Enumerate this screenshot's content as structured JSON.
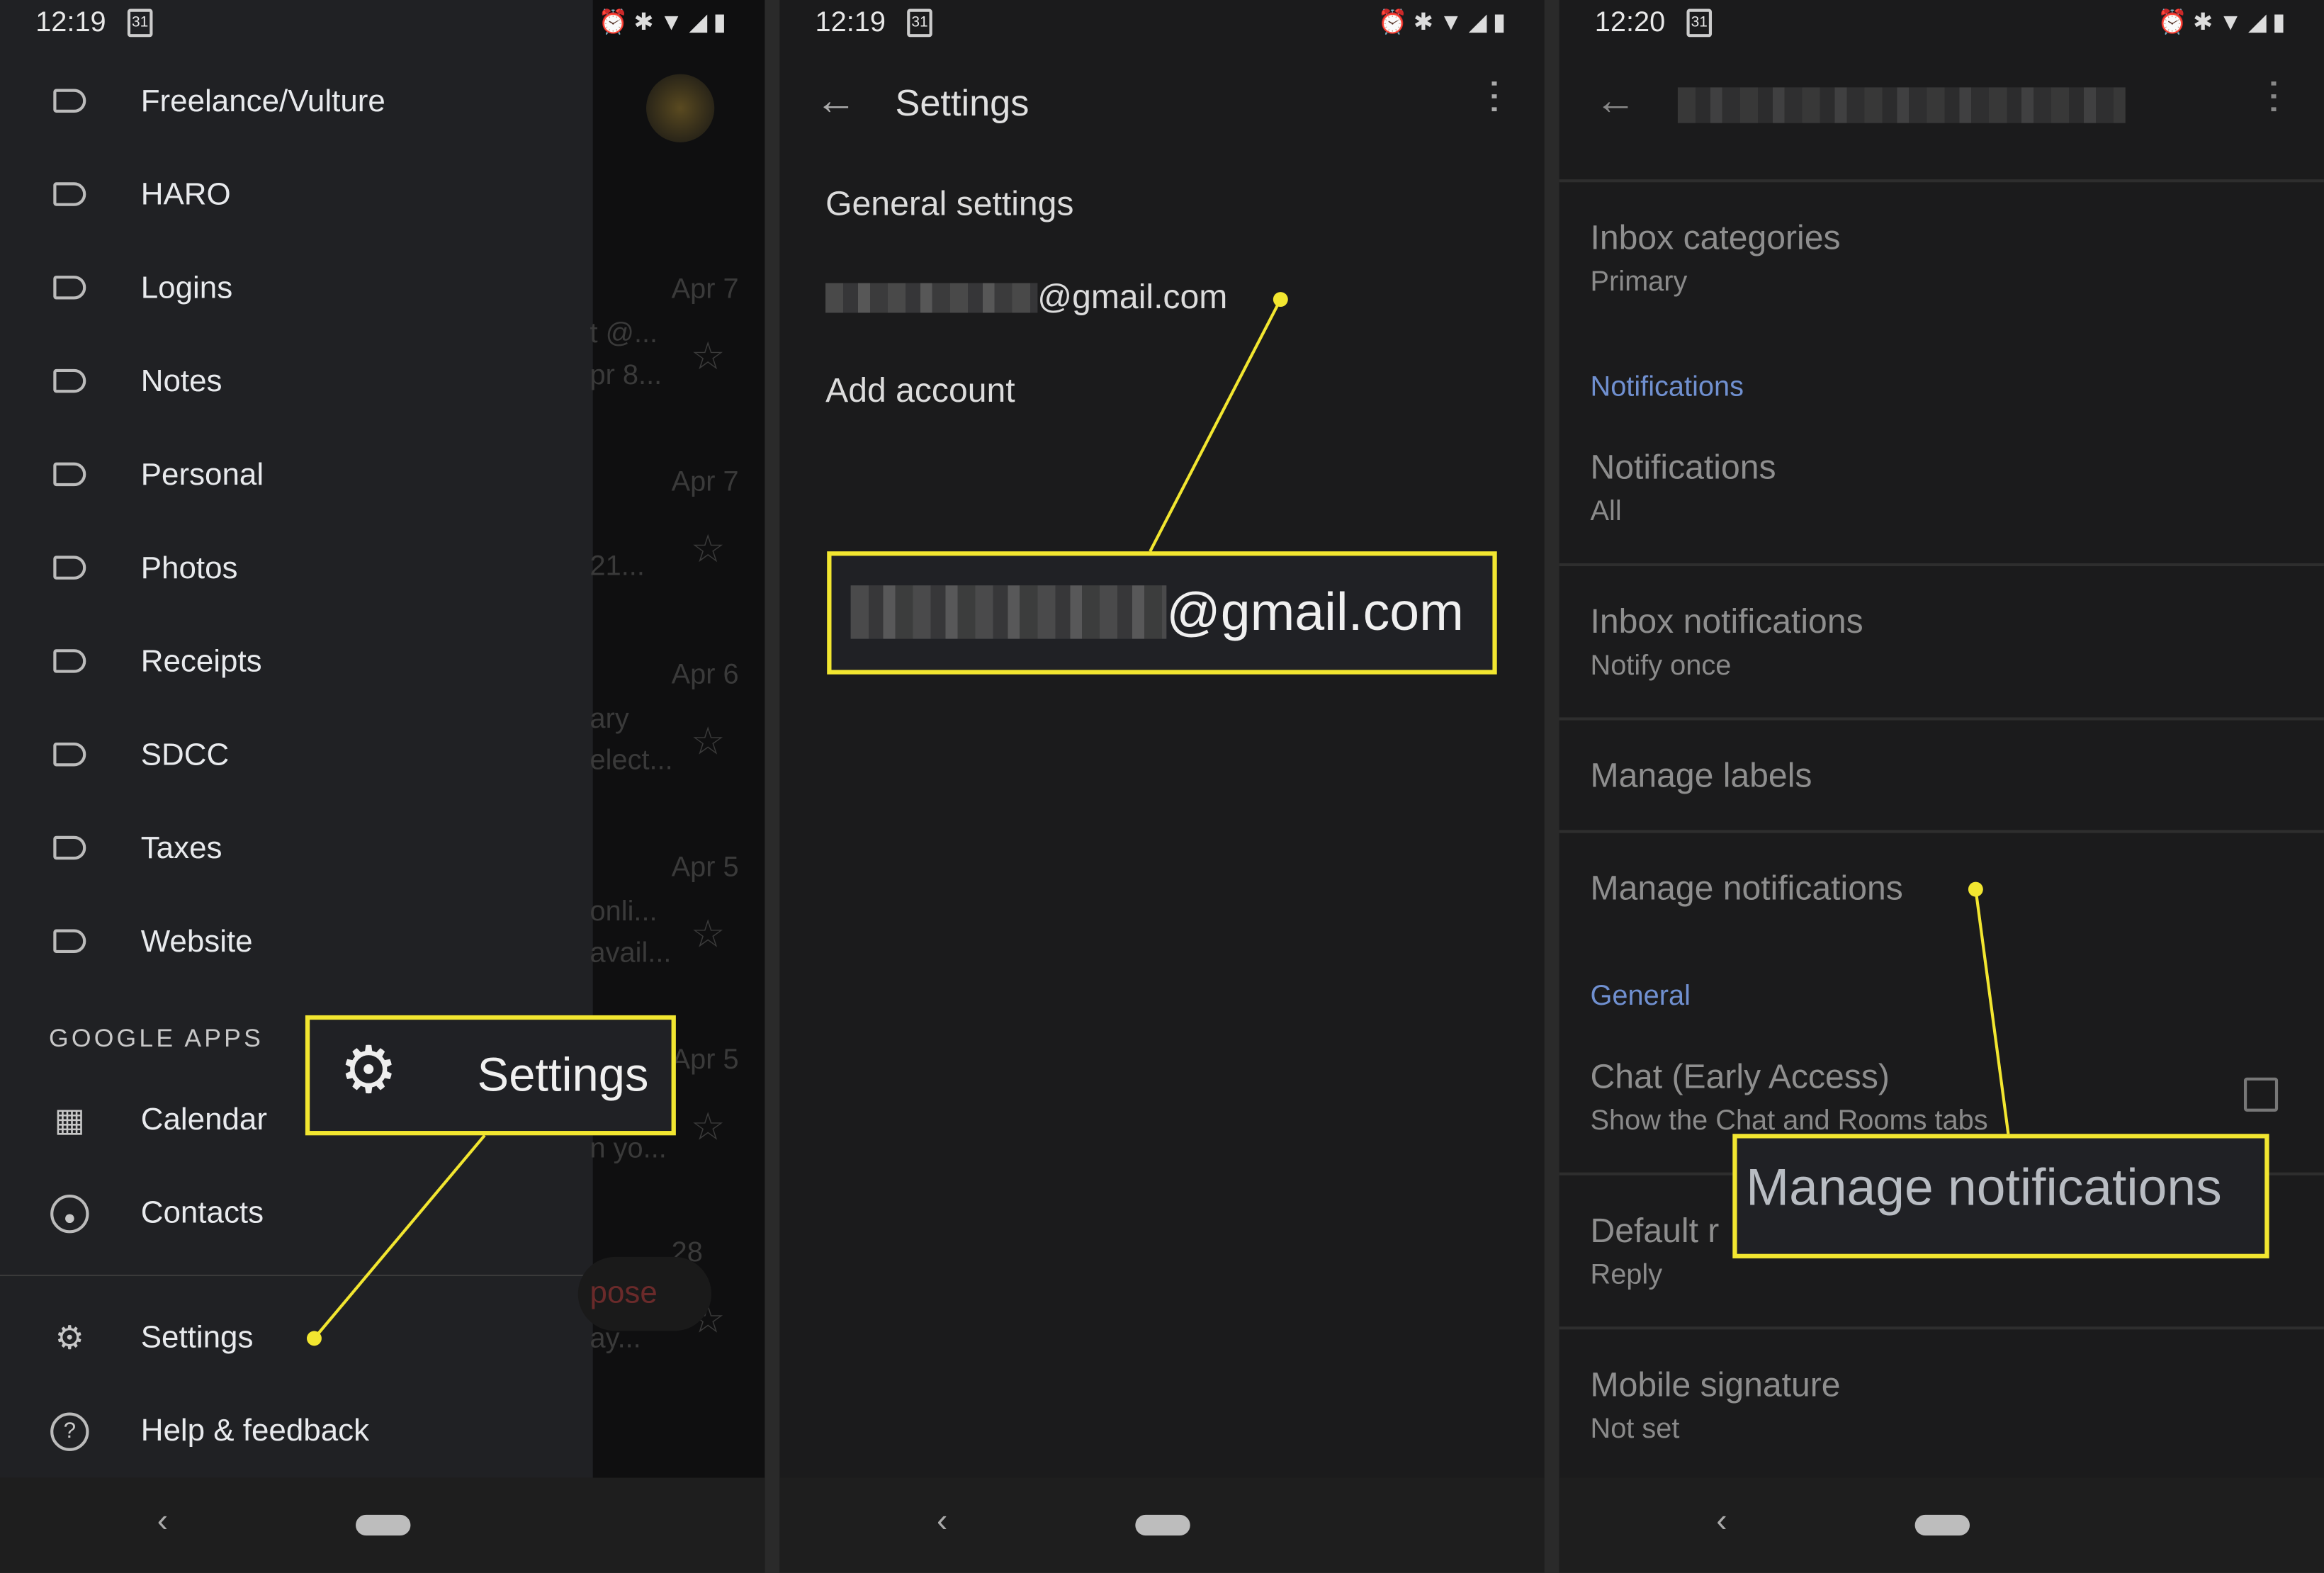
{
  "panel1": {
    "status": {
      "time": "12:19",
      "calendar_day": "31"
    },
    "labels": [
      "Freelance/Vulture",
      "HARO",
      "Logins",
      "Notes",
      "Personal",
      "Photos",
      "Receipts",
      "SDCC",
      "Taxes",
      "Website"
    ],
    "section_google_apps": "GOOGLE APPS",
    "apps": [
      {
        "label": "Calendar",
        "icon": "calendar-icon"
      },
      {
        "label": "Contacts",
        "icon": "contacts-icon"
      }
    ],
    "settings_label": "Settings",
    "help_label": "Help & feedback",
    "background_mail": {
      "dates": [
        "Apr 7",
        "Apr 7",
        "Apr 6",
        "Apr 5",
        "Apr 5",
        "28"
      ],
      "snippets": [
        "t @...",
        "pr 8...",
        "21...",
        "ary",
        "elect...",
        "onli...",
        "avail...",
        "n yo...",
        "ay..."
      ],
      "compose_label": "pose"
    },
    "callout_label": "Settings"
  },
  "panel2": {
    "status": {
      "time": "12:19",
      "calendar_day": "31"
    },
    "title": "Settings",
    "general_settings": "General settings",
    "account_email_suffix": "@gmail.com",
    "add_account": "Add account",
    "callout_email_suffix": "@gmail.com"
  },
  "panel3": {
    "status": {
      "time": "12:20",
      "calendar_day": "31"
    },
    "inbox_categories": {
      "title": "Inbox categories",
      "value": "Primary"
    },
    "section_notifications": "Notifications",
    "notifications": {
      "title": "Notifications",
      "value": "All"
    },
    "inbox_notifications": {
      "title": "Inbox notifications",
      "value": "Notify once"
    },
    "manage_labels": "Manage labels",
    "manage_notifications": "Manage notifications",
    "section_general": "General",
    "chat": {
      "title": "Chat (Early Access)",
      "value": "Show the Chat and Rooms tabs",
      "checked": false
    },
    "default_reply": {
      "title": "Default r",
      "value": "Reply"
    },
    "mobile_signature": {
      "title": "Mobile signature",
      "value": "Not set"
    },
    "callout_label": "Manage notifications"
  },
  "colors": {
    "callout_border": "#f2e630",
    "section_header": "#7090d0",
    "background": "#1b1b1c"
  }
}
